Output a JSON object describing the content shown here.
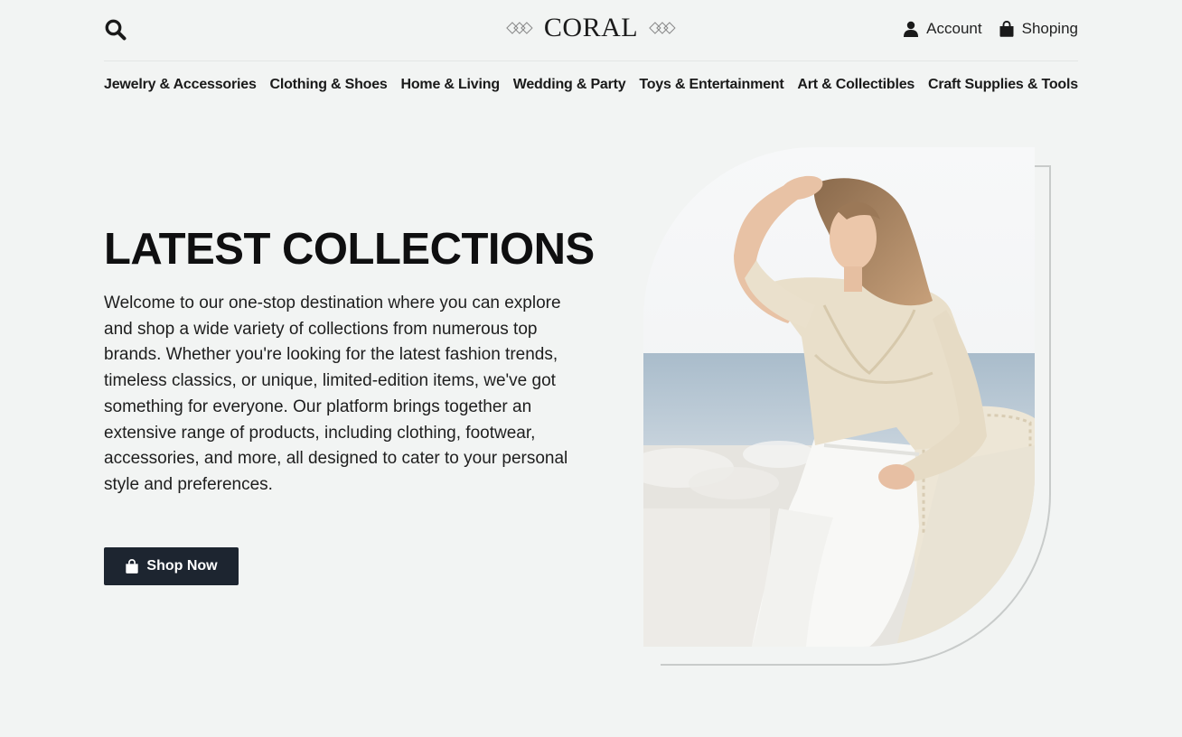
{
  "header": {
    "logo_text": "CORAL",
    "account_label": "Account",
    "shopping_label": "Shoping",
    "icons": {
      "search": "search-icon",
      "account": "user-icon",
      "shopping": "shopping-bag-icon",
      "logo_ornament": "ornament-icon"
    }
  },
  "nav": {
    "items": [
      "Jewelry & Accessories",
      "Clothing & Shoes",
      "Home & Living",
      "Wedding & Party",
      "Toys & Entertainment",
      "Art & Collectibles",
      "Craft Supplies & Tools"
    ]
  },
  "hero": {
    "title": "LATEST COLLECTIONS",
    "description": "Welcome to our one-stop destination where you can explore and shop a wide variety of collections from numerous top brands. Whether you're looking for the latest fashion trends, timeless classics, or unique, limited-edition items, we've got something for everyone. Our platform brings together an extensive range of products, including clothing, footwear, accessories, and more, all designed to cater to your personal style and preferences.",
    "button_label": "Shop Now"
  },
  "colors": {
    "background": "#f2f4f3",
    "button": "#1d2530",
    "text": "#111111"
  }
}
